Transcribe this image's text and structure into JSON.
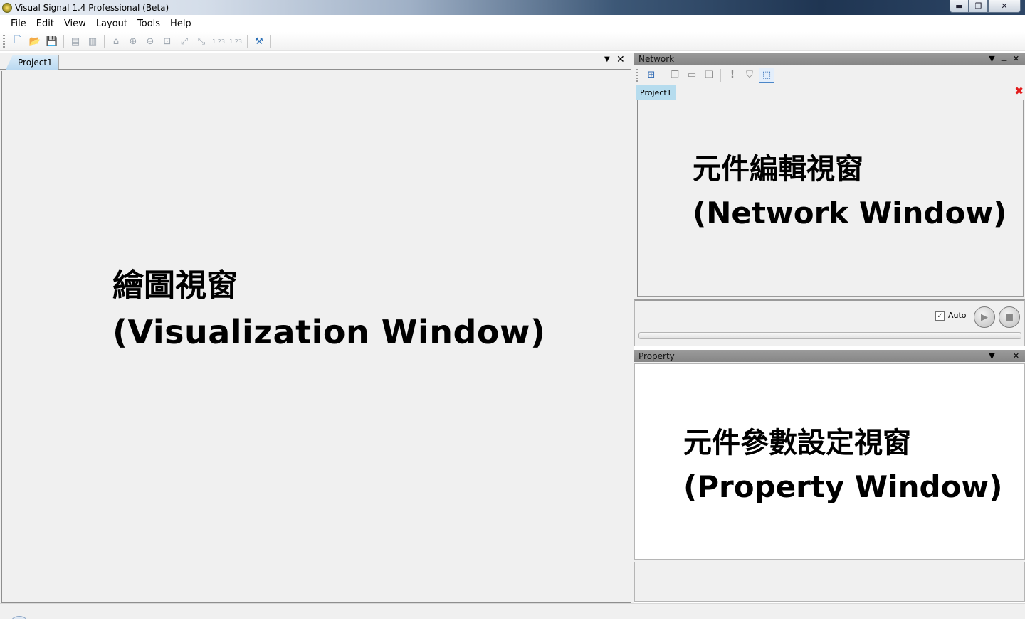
{
  "window": {
    "title": "Visual Signal 1.4 Professional (Beta)",
    "controls": {
      "minimize": "▬",
      "maximize": "❐",
      "close": "✕"
    }
  },
  "menu": {
    "items": [
      {
        "label": "File"
      },
      {
        "label": "Edit"
      },
      {
        "label": "View"
      },
      {
        "label": "Layout"
      },
      {
        "label": "Tools"
      },
      {
        "label": "Help"
      }
    ]
  },
  "toolbar": {
    "icons": [
      {
        "name": "new-file-icon",
        "glyph": "🗋"
      },
      {
        "name": "open-folder-icon",
        "glyph": "📂"
      },
      {
        "name": "save-icon",
        "glyph": "💾"
      },
      {
        "name": "layout-a-icon",
        "glyph": "▤"
      },
      {
        "name": "layout-b-icon",
        "glyph": "▥"
      },
      {
        "name": "home-icon",
        "glyph": "⌂"
      },
      {
        "name": "zoom-in-icon",
        "glyph": "⊕"
      },
      {
        "name": "zoom-out-icon",
        "glyph": "⊖"
      },
      {
        "name": "zoom-fit-icon",
        "glyph": "⊡"
      },
      {
        "name": "zoom-x-icon",
        "glyph": "⤢"
      },
      {
        "name": "zoom-y-icon",
        "glyph": "⤡"
      },
      {
        "name": "axis-x-icon",
        "glyph": "1.23"
      },
      {
        "name": "axis-y-icon",
        "glyph": "1.23"
      },
      {
        "name": "tools-icon",
        "glyph": "⚒"
      }
    ]
  },
  "visualization": {
    "tab_label": "Project1",
    "dropdown_glyph": "▼",
    "close_glyph": "✕",
    "heading_zh": "繪圖視窗",
    "heading_en": "(Visualization Window)"
  },
  "network": {
    "header": "Network",
    "header_buttons": {
      "dropdown": "▼",
      "pin": "⊥",
      "close": "✕"
    },
    "toolbar_icons": [
      {
        "name": "add-block-icon",
        "glyph": "⊞"
      },
      {
        "name": "copy-block-icon",
        "glyph": "❐"
      },
      {
        "name": "block-save-icon",
        "glyph": "▭"
      },
      {
        "name": "block-paste-icon",
        "glyph": "❏"
      },
      {
        "name": "warning-icon",
        "glyph": "!"
      },
      {
        "name": "tag-icon",
        "glyph": "⛉"
      },
      {
        "name": "selection-icon",
        "glyph": "⬚"
      }
    ],
    "tab_label": "Project1",
    "tab_close_glyph": "✖",
    "heading_zh": "元件編輯視窗",
    "heading_en": "(Network Window)",
    "auto_label": "Auto",
    "auto_checked": true,
    "checkbox_glyph": "✓",
    "play_glyph": "▶",
    "stop_glyph": "■"
  },
  "property": {
    "header": "Property",
    "header_buttons": {
      "dropdown": "▼",
      "pin": "⊥",
      "close": "✕"
    },
    "heading_zh": "元件參數設定視窗",
    "heading_en": "(Property Window)"
  }
}
